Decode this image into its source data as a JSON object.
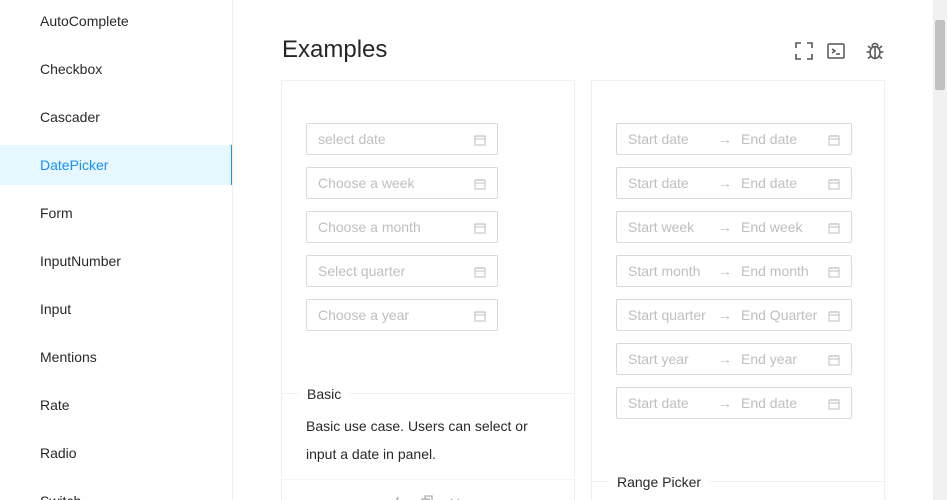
{
  "sidebar": {
    "items": [
      {
        "label": "AutoComplete"
      },
      {
        "label": "Checkbox"
      },
      {
        "label": "Cascader"
      },
      {
        "label": "DatePicker",
        "active": true
      },
      {
        "label": "Form"
      },
      {
        "label": "InputNumber"
      },
      {
        "label": "Input"
      },
      {
        "label": "Mentions"
      },
      {
        "label": "Rate"
      },
      {
        "label": "Radio"
      },
      {
        "label": "Switch"
      }
    ]
  },
  "main": {
    "title": "Examples",
    "toolbar_icons": [
      "expand-icon",
      "code-icon",
      "bug-icon"
    ]
  },
  "basic_card": {
    "pickers": [
      {
        "placeholder": "select date"
      },
      {
        "placeholder": "Choose a week"
      },
      {
        "placeholder": "Choose a month"
      },
      {
        "placeholder": "Select quarter"
      },
      {
        "placeholder": "Choose a year"
      }
    ],
    "title": "Basic",
    "description": "Basic use case. Users can select or input a date in panel."
  },
  "range_card": {
    "pickers": [
      {
        "start": "Start date",
        "end": "End date"
      },
      {
        "start": "Start date",
        "end": "End date"
      },
      {
        "start": "Start week",
        "end": "End week"
      },
      {
        "start": "Start month",
        "end": "End month"
      },
      {
        "start": "Start quarter",
        "end": "End Quarter"
      },
      {
        "start": "Start year",
        "end": "End year"
      },
      {
        "start": "Start date",
        "end": "End date"
      }
    ],
    "title": "Range Picker",
    "arrow": "→"
  },
  "colors": {
    "accent": "#1890ff",
    "active_bg": "#e6f7ff",
    "placeholder": "#bfbfbf",
    "border": "#d9d9d9"
  }
}
